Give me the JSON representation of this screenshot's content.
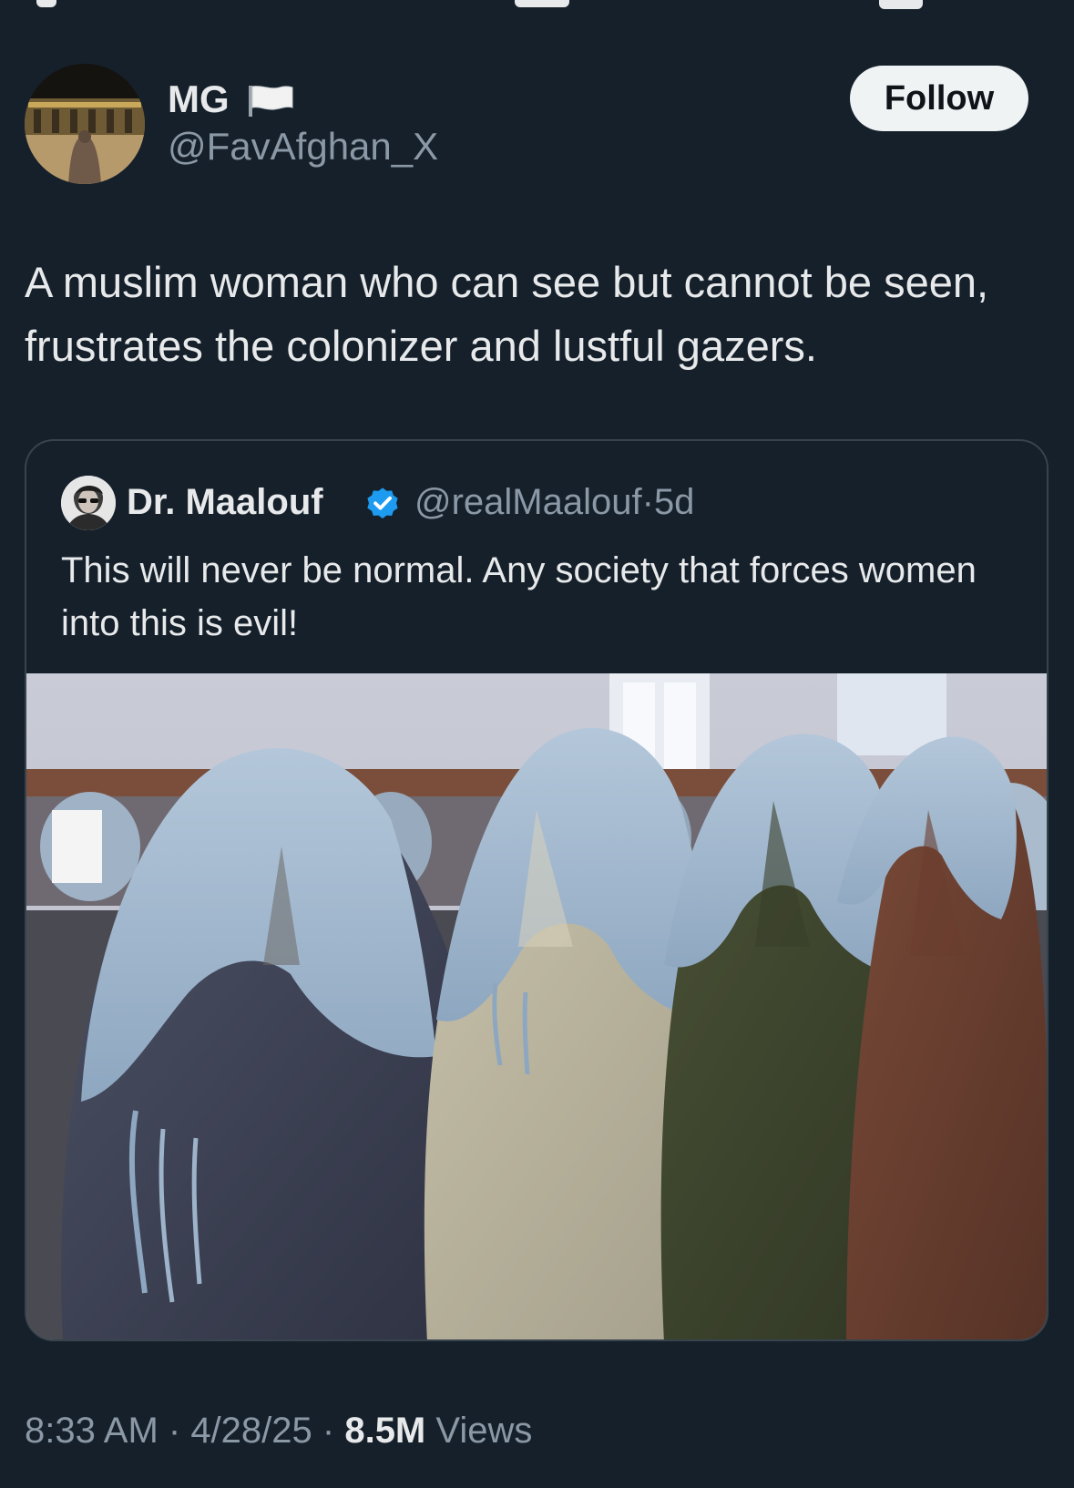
{
  "post": {
    "author": {
      "display_name": "MG",
      "name_emoji": "white-flag-icon",
      "handle": "@FavAfghan_X"
    },
    "follow_label": "Follow",
    "text": "A muslim woman who can see but cannot be seen, frustrates the colonizer and lustful gazers.",
    "timestamp": {
      "time": "8:33 AM",
      "separator": " · ",
      "date": "4/28/25"
    },
    "views": {
      "count": "8.5M",
      "label": "Views"
    }
  },
  "quoted_post": {
    "author": {
      "display_name": "Dr. Maalouf",
      "verified": true,
      "handle": "@realMaalouf",
      "age": "5d",
      "separator": "·"
    },
    "text": "This will never be normal. Any society that forces women into this is evil!",
    "media": {
      "icon": "photo-image"
    }
  },
  "colors": {
    "background": "#15202b",
    "primary_text": "#e7e9ea",
    "secondary_text": "#8b98a5",
    "border": "#38444d",
    "verified_blue": "#1d9bf0",
    "follow_bg": "#eff3f4"
  }
}
